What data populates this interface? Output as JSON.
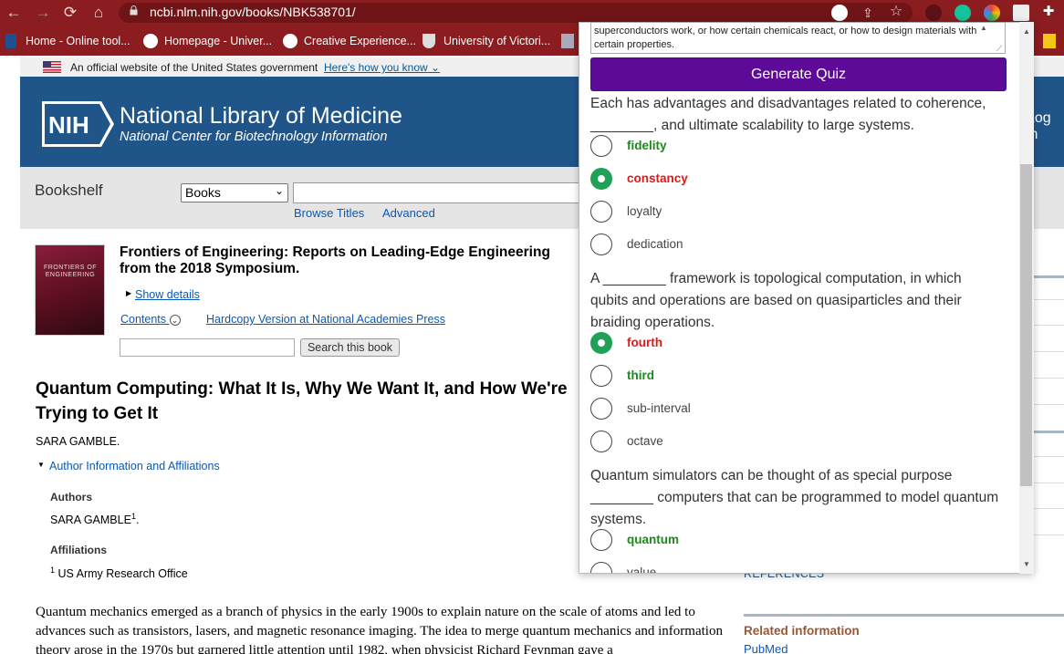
{
  "browser": {
    "url": "ncbi.nlm.nih.gov/books/NBK538701/",
    "bookmarks": [
      {
        "label": "Home - Online tool...",
        "icon": "bookmark-icon"
      },
      {
        "label": "Homepage - Univer...",
        "icon": "globe-icon"
      },
      {
        "label": "Creative Experience...",
        "icon": "globe-icon"
      },
      {
        "label": "University of Victori...",
        "icon": "crest-icon"
      }
    ]
  },
  "gov_banner": {
    "text": "An official website of the United States government",
    "link": "Here's how you know"
  },
  "header": {
    "logo": "NIH",
    "title": "National Library of Medicine",
    "subtitle": "National Center for Biotechnology Information",
    "login": "Log in"
  },
  "bookshelf": {
    "label": "Bookshelf",
    "db_selected": "Books",
    "browse_titles": "Browse Titles",
    "advanced": "Advanced"
  },
  "book": {
    "cover_text": "FRONTIERS OF ENGINEERING",
    "title": "Frontiers of Engineering: Reports on Leading-Edge Engineering from the 2018 Symposium.",
    "show_details": "Show details",
    "contents": "Contents",
    "hardcopy": "Hardcopy Version at National Academies Press",
    "search_button": "Search this book"
  },
  "chapter": {
    "title": "Quantum Computing: What It Is, Why We Want It, and How We're Trying to Get It",
    "author": "SARA GAMBLE.",
    "aff_toggle": "Author Information and Affiliations",
    "authors_heading": "Authors",
    "authors_value": "SARA GAMBLE",
    "authors_sup": "1",
    "affiliations_heading": "Affiliations",
    "affiliation_sup": "1",
    "affiliation_value": "US Army Research Office",
    "body": "Quantum mechanics emerged as a branch of physics in the early 1900s to explain nature on the scale of atoms and led to advances such as transistors, lasers, and magnetic resonance imaging. The idea to merge quantum mechanics and information theory arose in the 1970s but garnered little attention until 1982, when physicist Richard Feynman gave a"
  },
  "sidebar": {
    "references": "REFERENCES",
    "related_info": "Related information",
    "pubmed": "PubMed"
  },
  "quiz": {
    "textarea_text": "superconductors work, or how certain chemicals react, or how to design materials with certain properties.",
    "generate_button": "Generate Quiz",
    "questions": [
      {
        "text": "Each has advantages and disadvantages related to coherence, ________, and ultimate scalability to large systems.",
        "options": [
          "fidelity",
          "constancy",
          "loyalty",
          "dedication"
        ]
      },
      {
        "text": "A ________ framework is topological computation, in which qubits and operations are based on quasiparticles and their braiding operations.",
        "options": [
          "fourth",
          "third",
          "sub-interval",
          "octave"
        ]
      },
      {
        "text": "Quantum simulators can be thought of as special purpose ________ computers that can be programmed to model quantum systems.",
        "options": [
          "quantum",
          "value"
        ]
      }
    ]
  },
  "colors": {
    "chrome": "#8b1c1f",
    "nlm_blue": "#20558a",
    "quiz_button": "#5c0a97",
    "correct": "#1b8a1b",
    "wrong": "#e01818",
    "radio_selected": "#21a157"
  }
}
